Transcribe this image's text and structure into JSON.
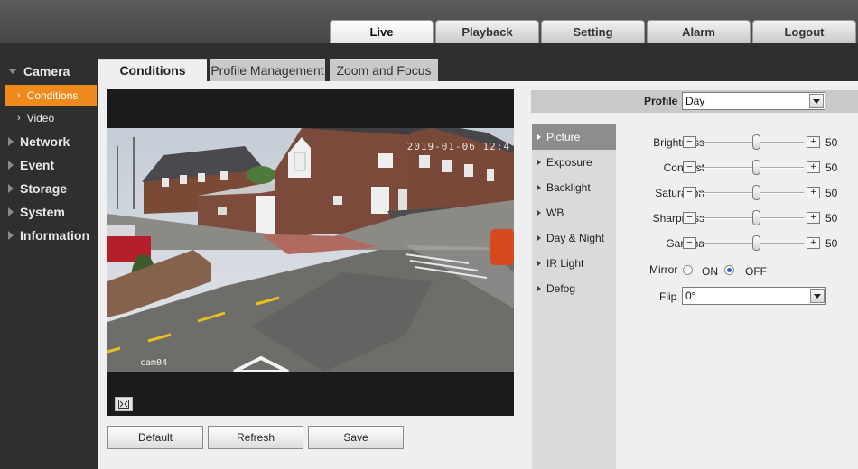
{
  "top_tabs": [
    {
      "label": "Live",
      "active": true
    },
    {
      "label": "Playback",
      "active": false
    },
    {
      "label": "Setting",
      "active": false
    },
    {
      "label": "Alarm",
      "active": false
    },
    {
      "label": "Logout",
      "active": false
    }
  ],
  "sidebar": {
    "camera": {
      "label": "Camera",
      "items": [
        {
          "label": "Conditions",
          "active": true
        },
        {
          "label": "Video",
          "active": false
        }
      ]
    },
    "groups": [
      {
        "label": "Network"
      },
      {
        "label": "Event"
      },
      {
        "label": "Storage"
      },
      {
        "label": "System"
      },
      {
        "label": "Information"
      }
    ]
  },
  "sub_tabs": [
    {
      "label": "Conditions",
      "active": true
    },
    {
      "label": "Profile Management",
      "active": false
    },
    {
      "label": "Zoom and Focus",
      "active": false
    }
  ],
  "video": {
    "osd_timestamp": "2019-01-06 12:4",
    "osd_camera_name": "cam04"
  },
  "buttons": {
    "default_label": "Default",
    "refresh_label": "Refresh",
    "save_label": "Save"
  },
  "profile": {
    "label": "Profile",
    "value": "Day"
  },
  "menu": [
    {
      "label": "Picture",
      "active": true
    },
    {
      "label": "Exposure",
      "active": false
    },
    {
      "label": "Backlight",
      "active": false
    },
    {
      "label": "WB",
      "active": false
    },
    {
      "label": "Day & Night",
      "active": false
    },
    {
      "label": "IR Light",
      "active": false
    },
    {
      "label": "Defog",
      "active": false
    }
  ],
  "picture": {
    "sliders": [
      {
        "label": "Brightness",
        "value": "50",
        "min": 0,
        "max": 100
      },
      {
        "label": "Contrast",
        "value": "50",
        "min": 0,
        "max": 100
      },
      {
        "label": "Saturation",
        "value": "50",
        "min": 0,
        "max": 100
      },
      {
        "label": "Sharpness",
        "value": "50",
        "min": 0,
        "max": 100
      },
      {
        "label": "Gamma",
        "value": "50",
        "min": 0,
        "max": 100
      }
    ],
    "minus": "−",
    "plus": "+",
    "mirror": {
      "label": "Mirror",
      "on_label": "ON",
      "off_label": "OFF",
      "selected": "OFF"
    },
    "flip": {
      "label": "Flip",
      "value": "0°"
    }
  },
  "colors": {
    "accent": "#f08a1c",
    "menu_active": "#8d8d8d"
  }
}
